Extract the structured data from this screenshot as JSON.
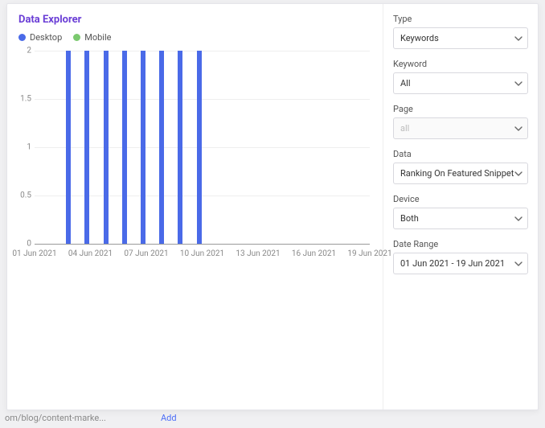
{
  "title": "Data Explorer",
  "title_color": "#6b3fd6",
  "legend": [
    {
      "label": "Desktop",
      "color": "#4a6ae8"
    },
    {
      "label": "Mobile",
      "color": "#7bc96f"
    }
  ],
  "sidebar": {
    "fields": [
      {
        "key": "type",
        "label": "Type",
        "value": "Keywords",
        "disabled": false
      },
      {
        "key": "keyword",
        "label": "Keyword",
        "value": "All",
        "disabled": false
      },
      {
        "key": "page",
        "label": "Page",
        "value": "all",
        "disabled": true
      },
      {
        "key": "data",
        "label": "Data",
        "value": "Ranking On Featured Snippet",
        "disabled": false
      },
      {
        "key": "device",
        "label": "Device",
        "value": "Both",
        "disabled": false
      },
      {
        "key": "date_range",
        "label": "Date Range",
        "value": "01 Jun 2021 - 19 Jun 2021",
        "disabled": false
      }
    ]
  },
  "background": {
    "row_hint": "om/blog/content-marke...",
    "add_label": "Add"
  },
  "chart_data": {
    "type": "bar",
    "title": "",
    "xlabel": "",
    "ylabel": "",
    "ylim": [
      0,
      2
    ],
    "yticks": [
      0,
      0.5,
      1,
      1.5,
      2
    ],
    "categories": [
      "01 Jun 2021",
      "02 Jun 2021",
      "03 Jun 2021",
      "04 Jun 2021",
      "05 Jun 2021",
      "06 Jun 2021",
      "07 Jun 2021",
      "08 Jun 2021",
      "09 Jun 2021",
      "10 Jun 2021",
      "11 Jun 2021",
      "12 Jun 2021",
      "13 Jun 2021",
      "14 Jun 2021",
      "15 Jun 2021",
      "16 Jun 2021",
      "17 Jun 2021",
      "18 Jun 2021",
      "19 Jun 2021"
    ],
    "xticks_shown": [
      "01 Jun 2021",
      "04 Jun 2021",
      "07 Jun 2021",
      "10 Jun 2021",
      "13 Jun 2021",
      "16 Jun 2021",
      "19 Jun 2021"
    ],
    "series": [
      {
        "name": "Desktop",
        "color": "#4a6ae8",
        "values": [
          0,
          0,
          2,
          2,
          2,
          2,
          2,
          2,
          2,
          2,
          0,
          0,
          0,
          0,
          0,
          0,
          0,
          0,
          0
        ]
      },
      {
        "name": "Mobile",
        "color": "#7bc96f",
        "values": [
          0,
          0,
          0,
          0,
          0,
          0,
          0,
          0,
          0,
          0,
          0,
          0,
          0,
          0,
          0,
          0,
          0,
          0,
          0
        ]
      }
    ]
  }
}
